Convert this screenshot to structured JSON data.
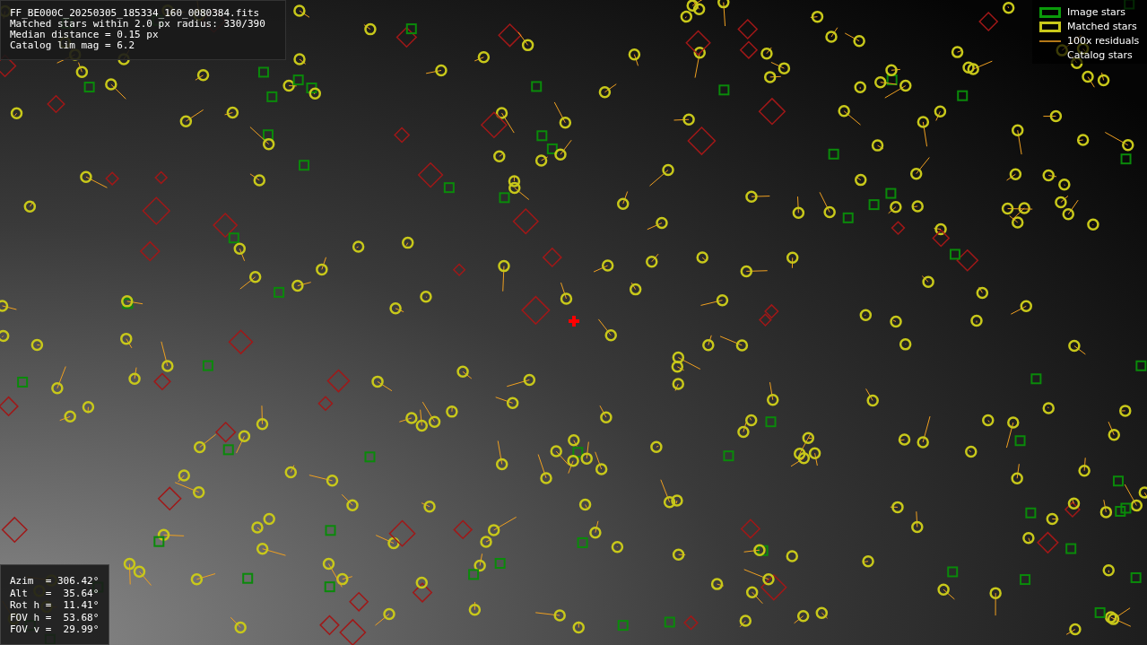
{
  "info_lines": [
    "FF_BE000C_20250305_185334_160_0080384.fits",
    "Matched stars within 2.0 px radius: 330/390",
    "Median distance = 0.15 px",
    "Catalog lim mag = 6.2"
  ],
  "legend": [
    {
      "kind": "image",
      "label": "Image stars"
    },
    {
      "kind": "matched",
      "label": "Matched stars"
    },
    {
      "kind": "residual",
      "label": "100x residuals"
    },
    {
      "kind": "catalog",
      "label": "Catalog stars"
    }
  ],
  "pointing": [
    "Azim  = 306.42°",
    "Alt   =  35.64°",
    "Rot h =  11.41°",
    "FOV h =  53.68°",
    "FOV v =  29.99°"
  ]
}
